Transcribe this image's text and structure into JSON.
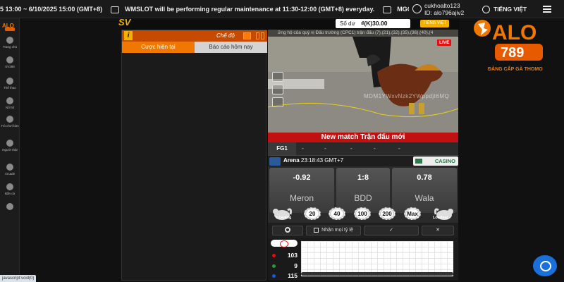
{
  "marquee": {
    "text1": "5 13:00 ~ 6/10/2025 15:00 (GMT+8)",
    "text2": "WMSLOT will be performing regular maintenance at 11:30-12:00 (GMT+8) everyday.",
    "text3": "MGGAMIN"
  },
  "user": {
    "username": "cukhoalto123",
    "id_label": "ID: alo796ajiv2"
  },
  "top_lang": "TIẾNG VIỆT",
  "logo": {
    "brand": "ALO",
    "number": "789",
    "tagline": "ĐẲNG CẤP GÀ THOMO"
  },
  "sidebar": {
    "items": [
      {
        "label": "Trang chủ"
      },
      {
        "label": "SV388"
      },
      {
        "label": "Thể thao"
      },
      {
        "label": "Nổ hũ"
      },
      {
        "label": "Trò chơi bàn"
      },
      {
        "label": "Người thật"
      },
      {
        "label": "Arcade"
      },
      {
        "label": "Bắn cá"
      }
    ]
  },
  "game": {
    "brand": "SV",
    "balance_label": "Số dư",
    "balance_value": "₫(K)30.00",
    "lang": "TIẾNG VIỆT",
    "mode_label": "Chế độ",
    "info_btn": "i",
    "tabs": [
      "Cược hiện tại",
      "Báo cáo hôm nay"
    ]
  },
  "video": {
    "ticker": "ững hộ của quý vị  Đấu trường (CPC1) trận đấu (7),(21),(32),(35),(36),(40),(4",
    "live": "LIVE",
    "watermark": "MDM1YWxvNzk2YWppdjI6MQ",
    "banner": "New match   Trận đấu mới"
  },
  "fg_row": {
    "label": "FG1",
    "cells": [
      "-",
      "-",
      "-",
      "-",
      "-"
    ]
  },
  "arena": {
    "name": "Arena",
    "time": "23:18:43 GMT+7",
    "casino": "CASINO"
  },
  "bets": {
    "meron": {
      "odd": "-0.92",
      "name": "Meron"
    },
    "bdd": {
      "odd": "1:8",
      "name": "BDD"
    },
    "wala": {
      "odd": "0.78",
      "name": "Wala"
    },
    "loading_left": "Loading",
    "loading_right": "Loading",
    "chips": [
      "20",
      "40",
      "100",
      "200",
      "Max"
    ]
  },
  "actions": {
    "accept_all": "Nhận mọi tỷ lệ",
    "confirm": "✓",
    "cancel": "✕"
  },
  "stats": {
    "red": "103",
    "green": "9",
    "blue": "115"
  },
  "colors": {
    "accent": "#f07800",
    "meron": "#e01010",
    "draw": "#2a9a3a",
    "wala": "#1a5ad8"
  },
  "status_bar": "javascript:void(0)"
}
